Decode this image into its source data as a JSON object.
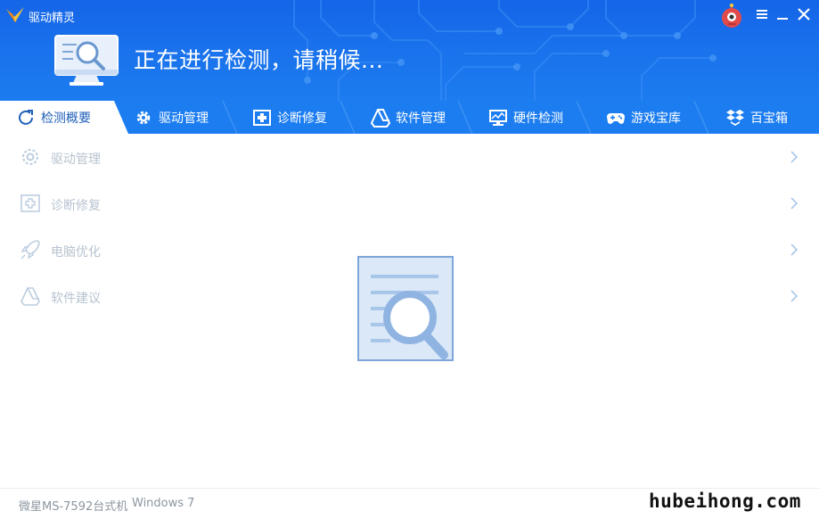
{
  "app": {
    "title": "驱动精灵",
    "status_text": "正在进行检测，请稍候..."
  },
  "window_controls": {
    "robot_icon": "robot-icon",
    "menu_icon": "menu-icon",
    "minimize_icon": "minimize-icon",
    "close_icon": "close-icon"
  },
  "tabs": [
    {
      "label": "检测概要",
      "icon": "refresh-icon",
      "active": true
    },
    {
      "label": "驱动管理",
      "icon": "gear-icon"
    },
    {
      "label": "诊断修复",
      "icon": "medical-cross-icon"
    },
    {
      "label": "软件管理",
      "icon": "software-triangle-icon"
    },
    {
      "label": "硬件检测",
      "icon": "monitor-chart-icon"
    },
    {
      "label": "游戏宝库",
      "icon": "gamepad-icon"
    },
    {
      "label": "百宝箱",
      "icon": "toolbox-icon"
    }
  ],
  "items": [
    {
      "label": "驱动管理",
      "icon": "gear-icon"
    },
    {
      "label": "诊断修复",
      "icon": "medical-cross-icon"
    },
    {
      "label": "电脑优化",
      "icon": "rocket-icon"
    },
    {
      "label": "软件建议",
      "icon": "software-triangle-icon"
    }
  ],
  "footer": {
    "machine": "微星MS-7592台式机",
    "os": "Windows 7",
    "watermark": "hubeihong.com"
  },
  "colors": {
    "header_blue": "#1a73ec",
    "tab_bar_blue": "#1c7df1",
    "active_tab_text": "#1f5fb8",
    "muted_item_text": "#b7c3cf",
    "icon_light_blue": "#a9c6ea"
  }
}
